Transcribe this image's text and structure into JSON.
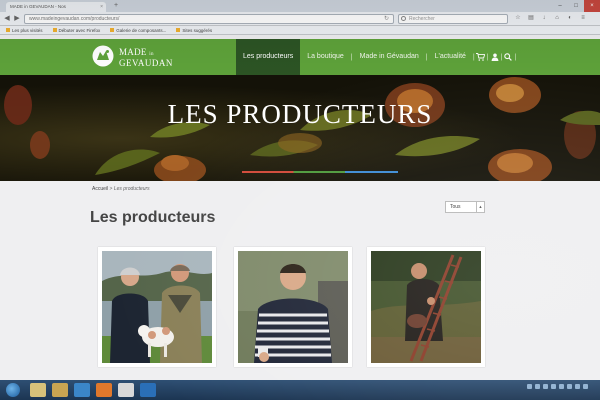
{
  "browser": {
    "tab_title": "MADE in GEVAUDAN - Nos",
    "url": "www.madeingevaudan.com/producteurs/",
    "search_placeholder": "Rechercher",
    "bookmarks": [
      "Les plus visités",
      "Débuter avec Firefox",
      "Galerie de composants...",
      "Sites suggérés"
    ]
  },
  "site": {
    "logo": {
      "line1": "MADE",
      "line1_small": "in",
      "line2": "GEVAUDAN"
    },
    "nav": [
      {
        "label": "Les producteurs",
        "active": true
      },
      {
        "label": "La boutique"
      },
      {
        "label": "Made in Gévaudan"
      },
      {
        "label": "L'actualité"
      }
    ],
    "nav_icons": [
      "cart-icon",
      "user-icon",
      "search-icon"
    ],
    "hero_title": "LES PRODUCTEURS",
    "breadcrumb": {
      "home": "Accueil",
      "separator": ">",
      "current": "Les producteurs"
    },
    "page_title": "Les producteurs",
    "sort_select": {
      "value": "Tous"
    },
    "producers": [
      {
        "photo": "two-farmers-with-lamb"
      },
      {
        "photo": "man-in-striped-sweater"
      },
      {
        "photo": "man-with-ladder-in-orchard"
      }
    ]
  },
  "colors": {
    "nav_green": "#5ea23a",
    "nav_active": "#2c5424",
    "rule_red": "#d14a3a",
    "rule_green": "#4e9a3c",
    "rule_blue": "#3c8bd4"
  }
}
